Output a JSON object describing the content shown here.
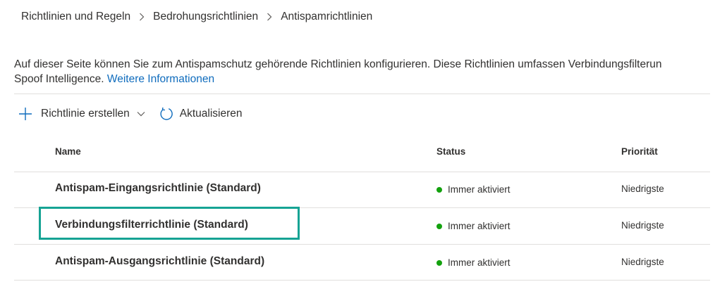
{
  "breadcrumb": {
    "items": [
      "Richtlinien und Regeln",
      "Bedrohungsrichtlinien",
      "Antispamrichtlinien"
    ]
  },
  "description": {
    "text": "Auf dieser Seite können Sie zum Antispamschutz gehörende Richtlinien konfigurieren. Diese Richtlinien umfassen Verbindungsfilterun",
    "line2": "Spoof Intelligence.",
    "link": "Weitere Informationen"
  },
  "toolbar": {
    "create_label": "Richtlinie erstellen",
    "refresh_label": "Aktualisieren"
  },
  "table": {
    "headers": {
      "name": "Name",
      "status": "Status",
      "priority": "Priorität"
    },
    "rows": [
      {
        "name": "Antispam-Eingangsrichtlinie (Standard)",
        "status": "Immer aktiviert",
        "priority": "Niedrigste"
      },
      {
        "name": "Verbindungsfilterrichtlinie (Standard)",
        "status": "Immer aktiviert",
        "priority": "Niedrigste"
      },
      {
        "name": "Antispam-Ausgangsrichtlinie (Standard)",
        "status": "Immer aktiviert",
        "priority": "Niedrigste"
      }
    ]
  },
  "colors": {
    "status_dot": "#13a10e",
    "link": "#0f6cbd",
    "highlight": "#16a394"
  },
  "icons": {
    "breadcrumb_separator": "chevron-right-icon",
    "create": "plus-icon",
    "create_dropdown": "chevron-down-icon",
    "refresh": "refresh-icon"
  }
}
